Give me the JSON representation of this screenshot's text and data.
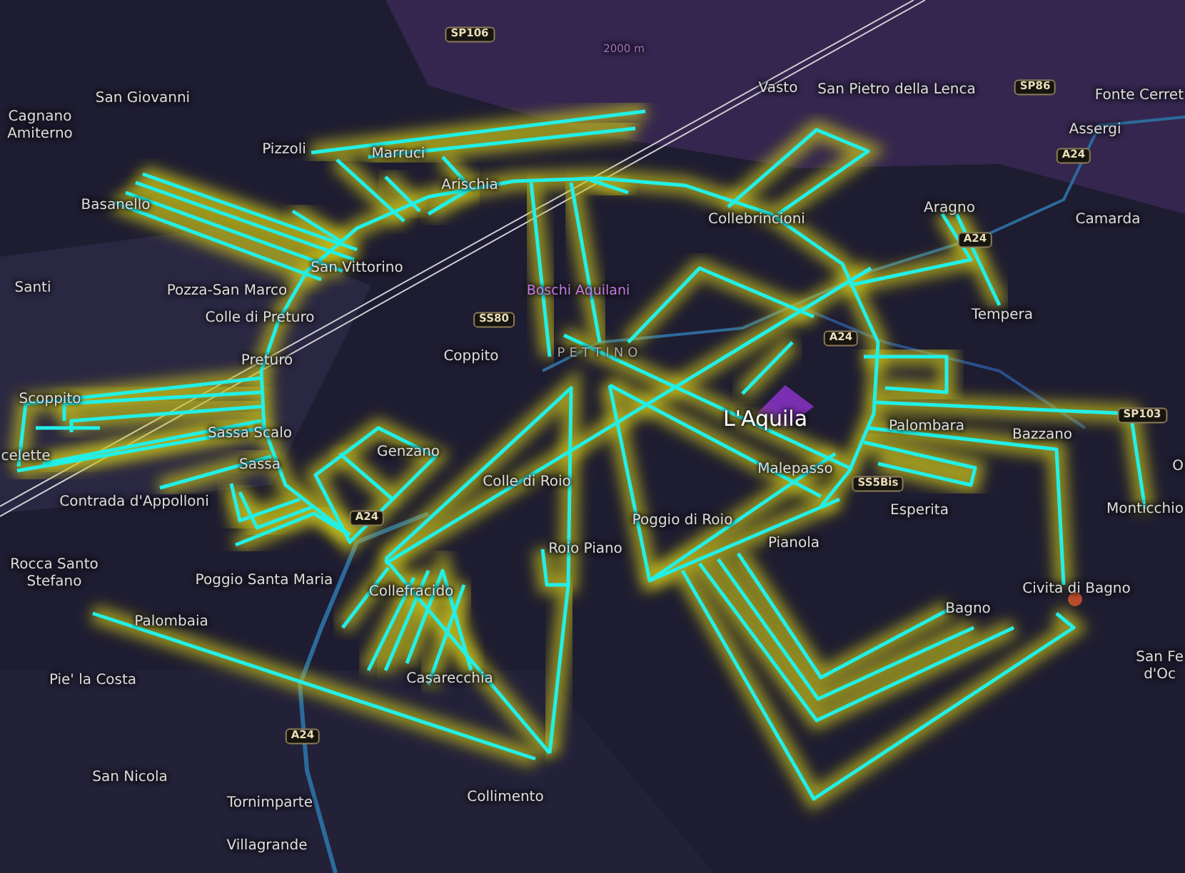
{
  "map": {
    "labels": [
      {
        "kind": "shield",
        "text": "SP106"
      },
      {
        "kind": "elevation",
        "text": "2000 m"
      },
      {
        "kind": "town",
        "text": "San Giovanni"
      },
      {
        "kind": "town",
        "text": "Vasto"
      },
      {
        "kind": "town",
        "text": "San Pietro della Lenca"
      },
      {
        "kind": "shield",
        "text": "SP86"
      },
      {
        "kind": "town",
        "text": "Fonte Cerret"
      },
      {
        "kind": "town",
        "text": "Cagnano\nAmiterno"
      },
      {
        "kind": "town",
        "text": "Assergi"
      },
      {
        "kind": "town",
        "text": "Pizzoli"
      },
      {
        "kind": "town",
        "text": "Marruci"
      },
      {
        "kind": "shield",
        "text": "A24"
      },
      {
        "kind": "town",
        "text": "Arischia"
      },
      {
        "kind": "town",
        "text": "Basanello"
      },
      {
        "kind": "town",
        "text": "Collebrincioni"
      },
      {
        "kind": "town",
        "text": "Aragno"
      },
      {
        "kind": "town",
        "text": "Camarda"
      },
      {
        "kind": "shield",
        "text": "A24"
      },
      {
        "kind": "town",
        "text": "San Vittorino"
      },
      {
        "kind": "town",
        "text": "Santi"
      },
      {
        "kind": "town",
        "text": "Pozza-San Marco"
      },
      {
        "kind": "poi",
        "text": "Boschi Aquilani"
      },
      {
        "kind": "town",
        "text": "Colle di Preturo"
      },
      {
        "kind": "shield",
        "text": "SS80"
      },
      {
        "kind": "town",
        "text": "Tempera"
      },
      {
        "kind": "shield",
        "text": "A24"
      },
      {
        "kind": "town",
        "text": "Preturo"
      },
      {
        "kind": "town",
        "text": "Coppito"
      },
      {
        "kind": "district",
        "text": "PETTINO"
      },
      {
        "kind": "town",
        "text": "Scoppito"
      },
      {
        "kind": "town",
        "text": "Sassa Scalo"
      },
      {
        "kind": "city",
        "text": "L'Aquila"
      },
      {
        "kind": "town",
        "text": "Palombara"
      },
      {
        "kind": "town",
        "text": "Bazzano"
      },
      {
        "kind": "shield",
        "text": "SP103"
      },
      {
        "kind": "town",
        "text": "celette"
      },
      {
        "kind": "town",
        "text": "Sassa"
      },
      {
        "kind": "town",
        "text": "Genzano"
      },
      {
        "kind": "town",
        "text": "Colle di Roio"
      },
      {
        "kind": "town",
        "text": "Malepasso"
      },
      {
        "kind": "shield",
        "text": "SS5Bis"
      },
      {
        "kind": "town",
        "text": "O"
      },
      {
        "kind": "town",
        "text": "Contrada d'Appolloni"
      },
      {
        "kind": "shield",
        "text": "A24"
      },
      {
        "kind": "town",
        "text": "Poggio di Roio"
      },
      {
        "kind": "town",
        "text": "Esperita"
      },
      {
        "kind": "town",
        "text": "Monticchio"
      },
      {
        "kind": "town",
        "text": "Roio Piano"
      },
      {
        "kind": "town",
        "text": "Pianola"
      },
      {
        "kind": "town",
        "text": "Rocca Santo\nStefano"
      },
      {
        "kind": "town",
        "text": "Poggio Santa Maria"
      },
      {
        "kind": "town",
        "text": "Collefracido"
      },
      {
        "kind": "town",
        "text": "Civita di Bagno"
      },
      {
        "kind": "town",
        "text": "Palombaia"
      },
      {
        "kind": "town",
        "text": "Bagno"
      },
      {
        "kind": "town",
        "text": "Pie' la Costa"
      },
      {
        "kind": "town",
        "text": "Casarecchia"
      },
      {
        "kind": "town",
        "text": "San Fe\nd'Oc"
      },
      {
        "kind": "shield",
        "text": "A24"
      },
      {
        "kind": "town",
        "text": "San Nicola"
      },
      {
        "kind": "town",
        "text": "Tornimparte"
      },
      {
        "kind": "town",
        "text": "Collimento"
      },
      {
        "kind": "town",
        "text": "Villagrande"
      }
    ]
  }
}
